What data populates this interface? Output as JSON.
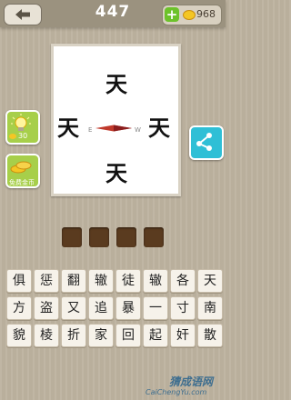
{
  "header": {
    "level": "447",
    "coins": "968"
  },
  "picture": {
    "chars": [
      "天",
      "天",
      "天",
      "天"
    ],
    "compass_e": "E",
    "compass_w": "W"
  },
  "side": {
    "hint_cost": "30",
    "free_coins_label": "免费金币"
  },
  "answer": {
    "slots": 4
  },
  "keyboard": {
    "row1": [
      "俱",
      "惩",
      "翻",
      "辙",
      "徒",
      "辙",
      "各",
      "天"
    ],
    "row2": [
      "方",
      "盗",
      "又",
      "追",
      "暴",
      "一",
      "寸",
      "南"
    ],
    "row3": [
      "貌",
      "棱",
      "折",
      "家",
      "回",
      "起",
      "奸",
      "散"
    ]
  },
  "watermark": {
    "cn": "猜成语网",
    "url": "CaiChengYu.com"
  },
  "colors": {
    "accent_green": "#a7cf4a",
    "share_blue": "#2fbfd6",
    "slot_brown": "#5a3b1f"
  }
}
